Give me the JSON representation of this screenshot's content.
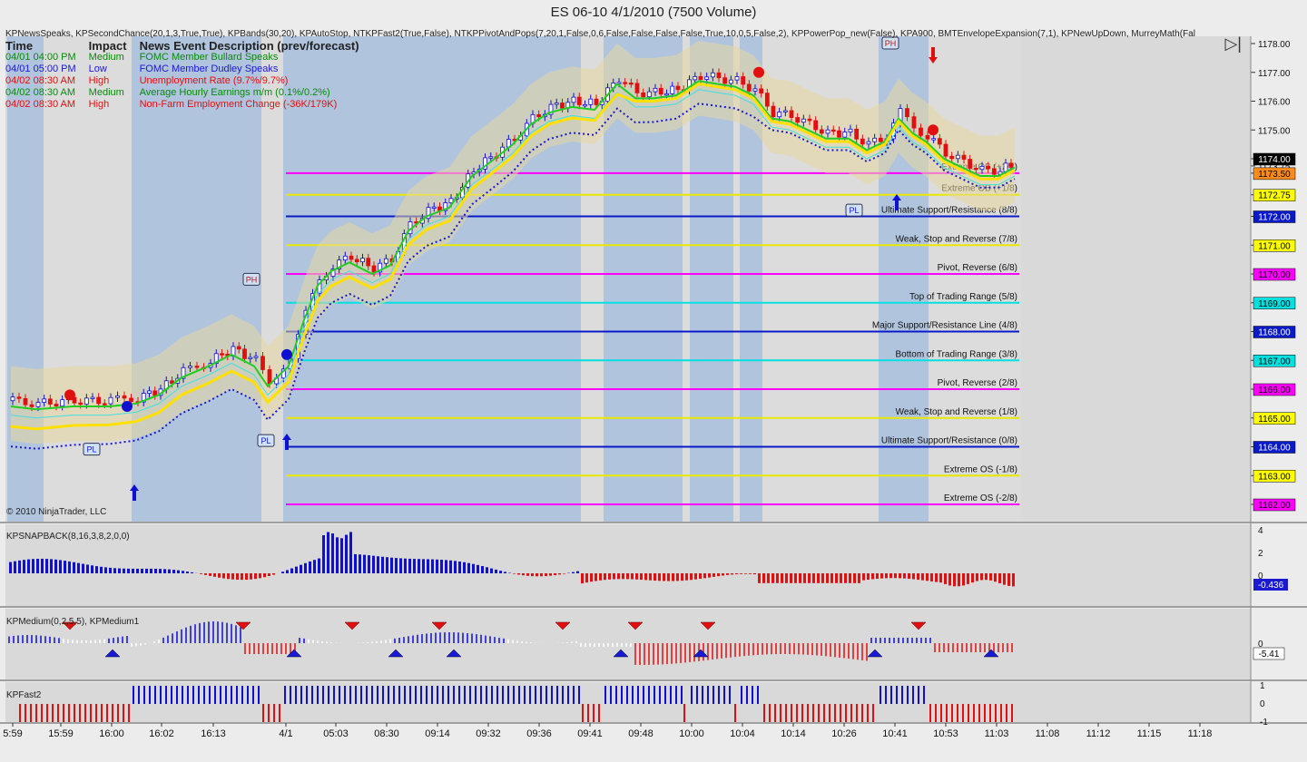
{
  "window": {
    "title": "ES 06-10  4/1/2010 (7500 Volume)",
    "indicator_bar": "KPNewsSpeaks, KPSecondChance(20,1,3,True,True), KPBands(30,20),  KPAutoStop,  NTKPFast2(True,False),  NTKPPivotAndPops(7,20,1,False,0,6,False,False,False,False,True,10,0,5,False,2),  KPPowerPop_new(False),  KPA900,  BMTEnvelopeExpansion(7,1),  KPNewUpDown,  MurreyMath(Fal"
  },
  "news": {
    "headers": {
      "time": "Time",
      "impact": "Impact",
      "desc": "News Event Description (prev/forecast)"
    },
    "rows": [
      {
        "time": "04/01 04:00 PM",
        "impact": "Medium",
        "desc": "FOMC Member Bullard Speaks",
        "color": "#0a8a0a"
      },
      {
        "time": "04/01 05:00 PM",
        "impact": "Low",
        "desc": "FOMC Member Dudley Speaks",
        "color": "#1a1ad0"
      },
      {
        "time": "04/02 08:30 AM",
        "impact": "High",
        "desc": "Unemployment Rate (9.7%/9.7%)",
        "color": "#e01010"
      },
      {
        "time": "04/02 08:30 AM",
        "impact": "Medium",
        "desc": "Average Hourly Earnings m/m (0.1%/0.2%)",
        "color": "#0a8a0a"
      },
      {
        "time": "04/02 08:30 AM",
        "impact": "High",
        "desc": "Non-Farm Employment Change (-36K/179K)",
        "color": "#e01010"
      }
    ]
  },
  "copyright": "© 2010 NinjaTrader, LLC",
  "murrey_lines": [
    {
      "price": 1173.5,
      "label": "Extreme OB (+2/8)",
      "color": "#ff00ff"
    },
    {
      "price": 1172.75,
      "label": "Extreme OB (+1/8)",
      "color": "#e8e800"
    },
    {
      "price": 1172.0,
      "label": "Ultimate Support/Resistance (8/8)",
      "color": "#0a1ac8"
    },
    {
      "price": 1171.0,
      "label": "Weak, Stop and Reverse (7/8)",
      "color": "#e8e800"
    },
    {
      "price": 1170.0,
      "label": "Pivot, Reverse (6/8)",
      "color": "#ff00ff"
    },
    {
      "price": 1169.0,
      "label": "Top of Trading Range (5/8)",
      "color": "#00e0e0"
    },
    {
      "price": 1168.0,
      "label": "Major Support/Resistance Line (4/8)",
      "color": "#0a1ac8"
    },
    {
      "price": 1167.0,
      "label": "Bottom of Trading Range (3/8)",
      "color": "#00e0e0"
    },
    {
      "price": 1166.0,
      "label": "Pivot, Reverse (2/8)",
      "color": "#ff00ff"
    },
    {
      "price": 1165.0,
      "label": "Weak, Stop and Reverse (1/8)",
      "color": "#e8e800"
    },
    {
      "price": 1164.0,
      "label": "Ultimate Support/Resistance (0/8)",
      "color": "#0a1ac8"
    },
    {
      "price": 1163.0,
      "label": "Extreme OS (-1/8)",
      "color": "#e8e800"
    },
    {
      "price": 1162.0,
      "label": "Extreme OS (-2/8)",
      "color": "#ff00ff"
    }
  ],
  "price_axis": {
    "ticks": [
      "1178.00",
      "1177.00",
      "1176.00",
      "1175.00",
      "1174.00",
      "1173.75",
      "1173.50",
      "1172.75",
      "1172.00",
      "1171.00",
      "1170.00",
      "1169.00",
      "1168.00",
      "1167.00",
      "1166.00",
      "1165.00",
      "1164.00",
      "1163.00",
      "1162.00"
    ],
    "markers": [
      {
        "text": "1174.00",
        "bg": "#000000",
        "fg": "#ffffff"
      },
      {
        "text": "1173.50",
        "bg": "#ff8c1a",
        "fg": "#000000"
      },
      {
        "text": "1172.75",
        "bg": "#ffff00",
        "fg": "#000000"
      },
      {
        "text": "1172.00",
        "bg": "#0a1ac8",
        "fg": "#ffffff"
      },
      {
        "text": "1171.00",
        "bg": "#ffff00",
        "fg": "#000000"
      },
      {
        "text": "1170.00",
        "bg": "#ff00ff",
        "fg": "#000000"
      },
      {
        "text": "1169.00",
        "bg": "#00e0e0",
        "fg": "#000000"
      },
      {
        "text": "1168.00",
        "bg": "#0a1ac8",
        "fg": "#ffffff"
      },
      {
        "text": "1167.00",
        "bg": "#00e0e0",
        "fg": "#000000"
      },
      {
        "text": "1166.00",
        "bg": "#ff00ff",
        "fg": "#000000"
      },
      {
        "text": "1165.00",
        "bg": "#ffff00",
        "fg": "#000000"
      },
      {
        "text": "1164.00",
        "bg": "#0a1ac8",
        "fg": "#ffffff"
      },
      {
        "text": "1163.00",
        "bg": "#ffff00",
        "fg": "#000000"
      },
      {
        "text": "1162.00",
        "bg": "#ff00ff",
        "fg": "#000000"
      }
    ]
  },
  "pivot_labels": [
    {
      "text": "PH"
    },
    {
      "text": "PH"
    },
    {
      "text": "PL"
    },
    {
      "text": "PL"
    },
    {
      "text": "PL"
    }
  ],
  "panels": {
    "snapback": {
      "label": "KPSNAPBACK(8,16,3,8,2,0,0)",
      "ticks": [
        "4",
        "2",
        "0"
      ],
      "value": "-0.436"
    },
    "medium": {
      "label": "KPMedium(0,2,5,5), KPMedium1",
      "ticks": [
        "0"
      ],
      "value": "-5.41"
    },
    "fast": {
      "label": "KPFast2",
      "ticks": [
        "1",
        "0",
        "-1"
      ]
    }
  },
  "time_axis": [
    "5:59",
    "15:59",
    "16:00",
    "16:02",
    "16:13",
    "4/1",
    "05:03",
    "08:30",
    "09:14",
    "09:32",
    "09:36",
    "09:41",
    "09:48",
    "10:00",
    "10:04",
    "10:14",
    "10:26",
    "10:41",
    "10:53",
    "11:03",
    "11:08",
    "11:12",
    "11:15",
    "11:18"
  ],
  "colors": {
    "up": "#1010d0",
    "down": "#e01010",
    "band_dark": "#b0c4de",
    "band_light": "#dcdcdc",
    "panel_bg": "#d9d9d9"
  }
}
